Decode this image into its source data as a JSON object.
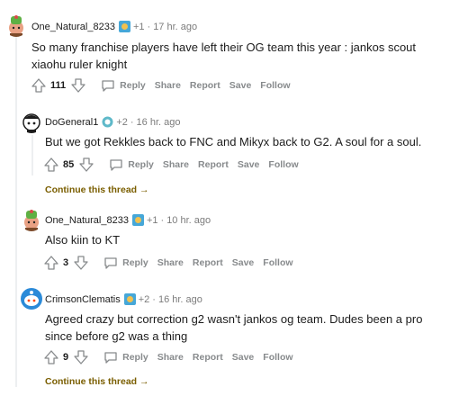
{
  "comments": [
    {
      "username": "One_Natural_8233",
      "karma": "+1",
      "time": "17 hr. ago",
      "body": "So many franchise players have left their OG team this year : jankos scout xiaohu ruler knight",
      "score": "111"
    },
    {
      "username": "DoGeneral1",
      "karma": "+2",
      "time": "16 hr. ago",
      "body": "But we got Rekkles back to FNC and Mikyx back to G2. A soul for a soul.",
      "score": "85"
    },
    {
      "username": "One_Natural_8233",
      "karma": "+1",
      "time": "10 hr. ago",
      "body": "Also kiin to KT",
      "score": "3"
    },
    {
      "username": "CrimsonClematis",
      "karma": "+2",
      "time": "16 hr. ago",
      "body": "Agreed crazy but correction g2 wasn't jankos og team. Dudes been a pro since before g2 was a thing",
      "score": "9"
    }
  ],
  "actions": {
    "reply": "Reply",
    "share": "Share",
    "report": "Report",
    "save": "Save",
    "follow": "Follow"
  },
  "continue_thread": "Continue this thread",
  "separator": "·"
}
